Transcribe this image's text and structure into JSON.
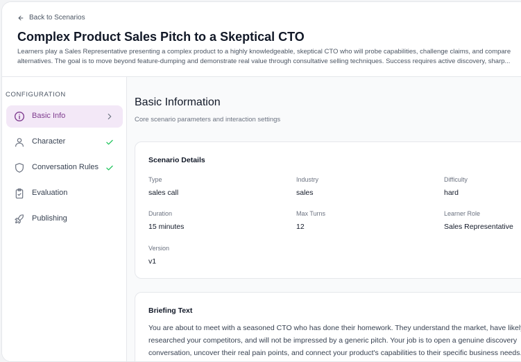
{
  "header": {
    "back_label": "Back to Scenarios",
    "title": "Complex Product Sales Pitch to a Skeptical CTO",
    "description": "Learners play a Sales Representative presenting a complex product to a highly knowledgeable, skeptical CTO who will probe capabilities, challenge claims, and compare alternatives. The goal is to move beyond feature-dumping and demonstrate real value through consultative selling techniques. Success requires active discovery, sharp..."
  },
  "sidebar": {
    "section_title": "CONFIGURATION",
    "items": [
      {
        "label": "Basic Info",
        "icon": "info-icon",
        "state": "active"
      },
      {
        "label": "Character",
        "icon": "user-icon",
        "state": "complete"
      },
      {
        "label": "Conversation Rules",
        "icon": "shield-icon",
        "state": "complete"
      },
      {
        "label": "Evaluation",
        "icon": "clipboard-check-icon",
        "state": "none"
      },
      {
        "label": "Publishing",
        "icon": "rocket-icon",
        "state": "none"
      }
    ]
  },
  "main": {
    "title": "Basic Information",
    "subtitle": "Core scenario parameters and interaction settings",
    "details": {
      "title": "Scenario Details",
      "type_label": "Type",
      "type_value": "sales call",
      "industry_label": "Industry",
      "industry_value": "sales",
      "difficulty_label": "Difficulty",
      "difficulty_value": "hard",
      "duration_label": "Duration",
      "duration_value": "15 minutes",
      "max_turns_label": "Max Turns",
      "max_turns_value": "12",
      "learner_role_label": "Learner Role",
      "learner_role_value": "Sales Representative",
      "version_label": "Version",
      "version_value": "v1"
    },
    "briefing": {
      "title": "Briefing Text",
      "text": "You are about to meet with a seasoned CTO who has done their homework. They understand the market, have likely researched your competitors, and will not be impressed by a generic pitch. Your job is to open a genuine discovery conversation, uncover their real pain points, and connect your product's capabilities to their specific business needs. Today's top salespeople..."
    }
  },
  "colors": {
    "accent": "#7e3a8e",
    "accent_bg": "#f3e8f7",
    "success": "#22c55e"
  }
}
